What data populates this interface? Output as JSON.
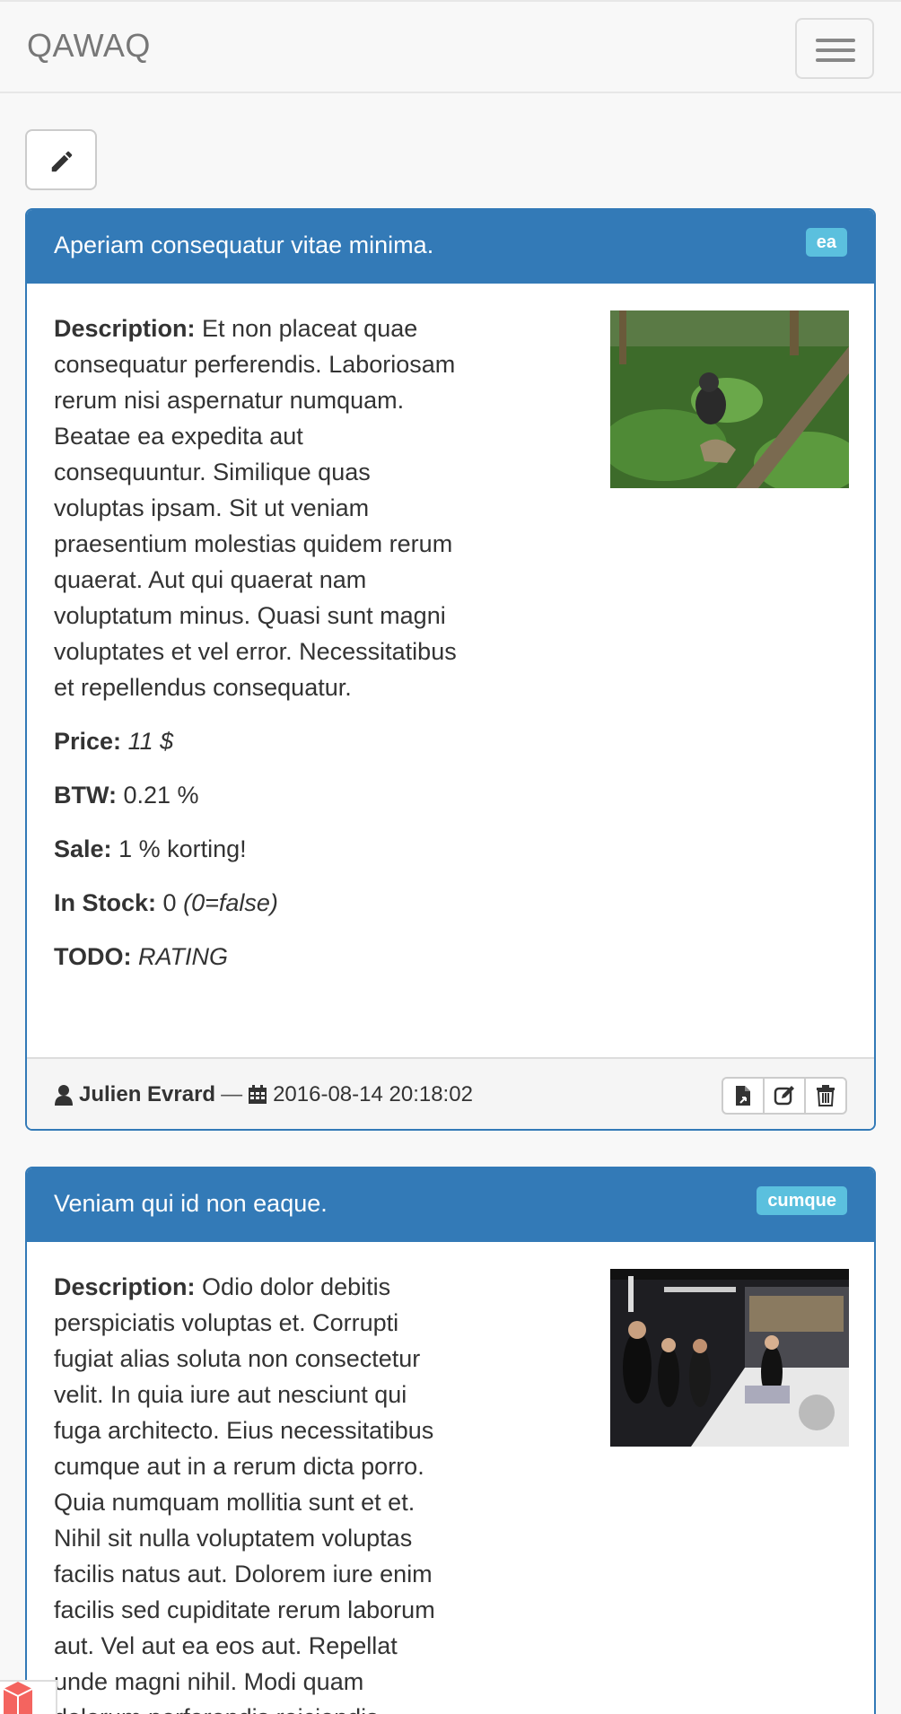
{
  "app": {
    "brand": "QAWAQ"
  },
  "toolbar": {
    "edit_icon": "pencil-icon",
    "menu_icon": "hamburger-icon"
  },
  "labels": {
    "description": "Description:",
    "price": "Price:",
    "btw": "BTW:",
    "sale": "Sale:",
    "in_stock": "In Stock:",
    "todo": "TODO:"
  },
  "products": [
    {
      "title": "Aperiam consequatur vitae minima.",
      "tag": "ea",
      "description": "Et non placeat quae consequatur perferendis. Laboriosam rerum nisi aspernatur numquam. Beatae ea expedita aut consequuntur. Similique quas voluptas ipsam. Sit ut veniam praesentium molestias quidem rerum quaerat. Aut qui quaerat nam voluptatum minus. Quasi sunt magni voluptates et vel error. Necessitatibus et repellendus consequatur.",
      "price": "11 $",
      "btw": "0.21 %",
      "sale": "1 % korting!",
      "in_stock_value": "0",
      "in_stock_note": "(0=false)",
      "todo": "RATING",
      "author": "Julien Evrard",
      "separator": "—",
      "date": "2016-08-14 20:18:02"
    },
    {
      "title": "Veniam qui id non eaque.",
      "tag": "cumque",
      "description": "Odio dolor debitis perspiciatis voluptas et. Corrupti fugiat alias soluta non consectetur velit. In quia iure aut nesciunt qui fuga architecto. Eius necessitatibus cumque aut in a rerum dicta porro. Quia numquam mollitia sunt et et. Nihil sit nulla voluptatem voluptas facilis natus aut. Dolorem iure enim facilis sed cupiditate rerum laborum aut. Vel aut ea eos aut. Repellat unde magni nihil. Modi quam dolorum perferendis reiciendis"
    }
  ],
  "colors": {
    "primary": "#337ab7",
    "badge": "#5bc0de",
    "navbar_bg": "#f8f8f8",
    "brand_text": "#777777"
  }
}
